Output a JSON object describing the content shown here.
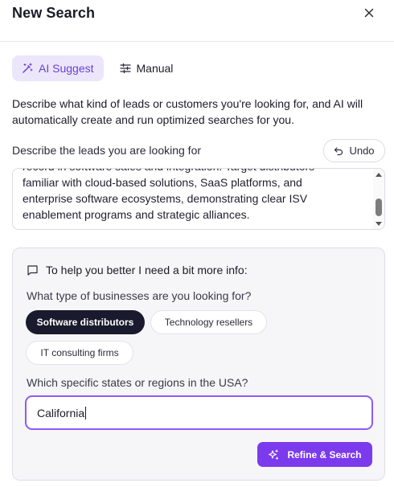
{
  "header": {
    "title": "New Search",
    "close_icon": "close-icon"
  },
  "tabs": [
    {
      "label": "AI Suggest",
      "icon": "magic-wand-icon",
      "active": true
    },
    {
      "label": "Manual",
      "icon": "sliders-icon",
      "active": false
    }
  ],
  "intro_text": "Describe what kind of leads or customers you're looking for, and AI will automatically create and run optimized searches for you.",
  "leads": {
    "label": "Describe the leads you are looking for",
    "undo_label": "Undo",
    "text_lines": [
      "record in software sales and integration. Target distributors",
      "familiar with cloud-based solutions, SaaS platforms, and",
      "enterprise software ecosystems, demonstrating clear ISV",
      "enablement programs and strategic alliances."
    ]
  },
  "info_panel": {
    "title": "To help you better I need a bit more info:",
    "question_business": "What type of businesses are you looking for?",
    "business_options": [
      {
        "label": "Software distributors",
        "selected": true
      },
      {
        "label": "Technology resellers",
        "selected": false
      },
      {
        "label": "IT consulting firms",
        "selected": false
      }
    ],
    "question_regions": "Which specific states or regions in the USA?",
    "region_value": "California",
    "refine_label": "Refine & Search"
  },
  "colors": {
    "accent": "#7c3aed",
    "accent_soft": "#ece6fb",
    "chip_selected": "#1a1a2e",
    "panel_bg": "#f6f6f9"
  }
}
